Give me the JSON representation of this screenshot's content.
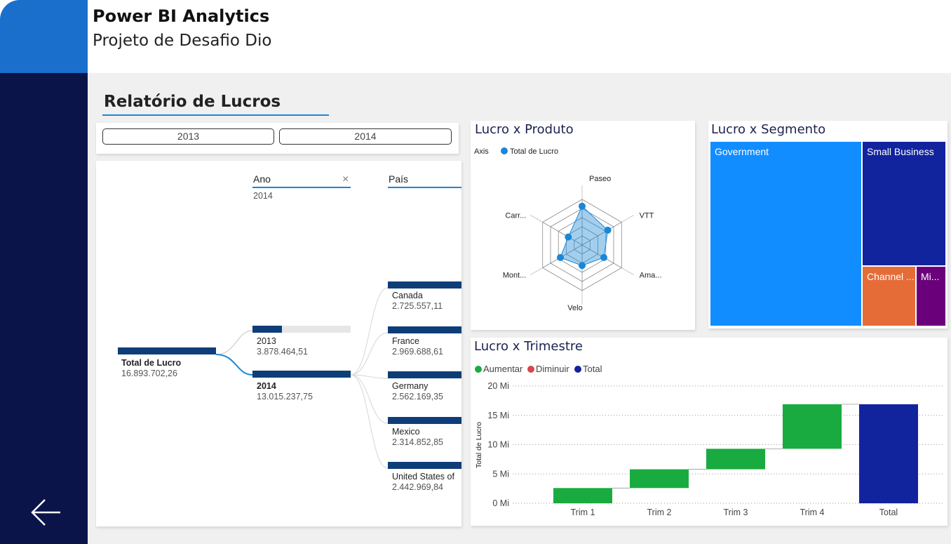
{
  "header": {
    "title": "Power BI Analytics",
    "subtitle": "Projeto de Desafio Dio"
  },
  "report": {
    "title": "Relatório de Lucros"
  },
  "slicer": {
    "options": [
      "2013",
      "2014"
    ]
  },
  "decomposition_tree": {
    "columns": {
      "ano": {
        "header": "Ano",
        "selected": "2014"
      },
      "pais": {
        "header": "País"
      }
    },
    "root": {
      "label": "Total de Lucro",
      "value": "16.893.702,26"
    },
    "years": [
      {
        "label": "2013",
        "value": "3.878.464,51",
        "fraction": 0.23
      },
      {
        "label": "2014",
        "value": "13.015.237,75",
        "fraction": 1.0
      }
    ],
    "countries": [
      {
        "label": "Canada",
        "value": "2.725.557,11"
      },
      {
        "label": "France",
        "value": "2.969.688,61"
      },
      {
        "label": "Germany",
        "value": "2.562.169,35"
      },
      {
        "label": "Mexico",
        "value": "2.314.852,85"
      },
      {
        "label": "United States of",
        "value": "2.442.969,84"
      }
    ],
    "colors": {
      "bar": "#0e3e78",
      "accent": "#1a86d8"
    }
  },
  "radar": {
    "title": "Lucro x Produto",
    "legend_axis_label": "Axis",
    "legend_series": "Total de Lucro",
    "color": "#1a86d8",
    "axes": [
      "Paseo",
      "VTT",
      "Ama...",
      "Velo",
      "Mont...",
      "Carr..."
    ],
    "values": [
      0.85,
      0.65,
      0.55,
      0.45,
      0.55,
      0.35
    ]
  },
  "treemap": {
    "title": "Lucro x Segmento",
    "cells": [
      {
        "label": "Government",
        "color": "#118dff"
      },
      {
        "label": "Small Business",
        "color": "#12239e"
      },
      {
        "label": "Channel ...",
        "color": "#e66c37"
      },
      {
        "label": "Mi...",
        "color": "#6b007b"
      }
    ]
  },
  "chart_data": {
    "type": "waterfall",
    "title": "Lucro x Trimestre",
    "ylabel": "Total de Lucro",
    "legend": [
      {
        "name": "Aumentar",
        "color": "#1aab40"
      },
      {
        "name": "Diminuir",
        "color": "#d64550"
      },
      {
        "name": "Total",
        "color": "#12239e"
      }
    ],
    "categories": [
      "Trim 1",
      "Trim 2",
      "Trim 3",
      "Trim 4",
      "Total"
    ],
    "values": [
      2.6,
      3.2,
      3.5,
      7.6,
      16.9
    ],
    "unit": "Mi",
    "yticks": [
      "0 Mi",
      "5 Mi",
      "10 Mi",
      "15 Mi",
      "20 Mi"
    ],
    "ylim": [
      0,
      20
    ]
  }
}
